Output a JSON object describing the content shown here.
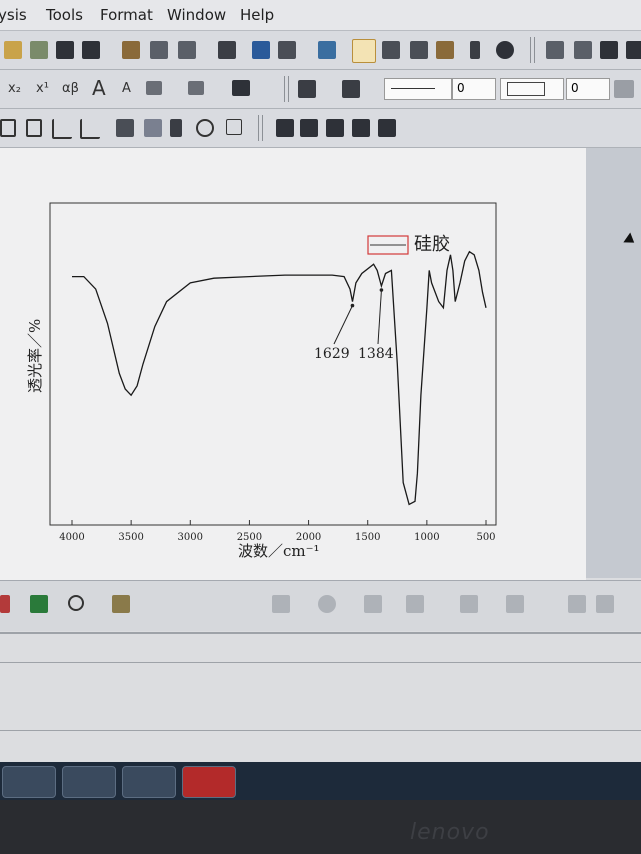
{
  "menu": {
    "items": [
      "ysis",
      "Tools",
      "Format",
      "Window",
      "Help"
    ]
  },
  "toolbar": {
    "sub_label": "x₂",
    "sup_label": "x¹",
    "greek_label": "αβ",
    "font_up_label": "A",
    "font_down_label": "A",
    "line_width_value": "0",
    "line_width_value2": "0"
  },
  "colors": {
    "legend_box": "#d33a3a",
    "curve": "#1a1a1a",
    "page": "#f0f0f1"
  },
  "chart_data": {
    "type": "line",
    "title": "",
    "xlabel": "波数／cm⁻¹",
    "ylabel": "透光率／%",
    "xlim": [
      4000,
      500
    ],
    "x_reversed": true,
    "xticks": [
      4000,
      3500,
      3000,
      2500,
      2000,
      1500,
      1000,
      500
    ],
    "y_ticks_shown": false,
    "grid": false,
    "legend": {
      "position": "top-right",
      "entries": [
        "硅胶"
      ]
    },
    "series": [
      {
        "name": "硅胶",
        "x": [
          4000,
          3900,
          3800,
          3700,
          3600,
          3550,
          3500,
          3450,
          3400,
          3300,
          3200,
          3000,
          2800,
          2500,
          2200,
          2000,
          1800,
          1700,
          1650,
          1629,
          1600,
          1550,
          1450,
          1420,
          1384,
          1350,
          1300,
          1250,
          1200,
          1150,
          1100,
          1080,
          1050,
          1000,
          980,
          960,
          900,
          860,
          830,
          800,
          780,
          760,
          720,
          680,
          640,
          600,
          560,
          530,
          500
        ],
        "y": [
          78,
          78,
          74,
          63,
          47,
          42,
          40,
          43,
          50,
          62,
          70,
          76,
          77.5,
          78,
          78.5,
          78.5,
          78.5,
          78,
          74,
          70,
          76,
          79,
          82,
          80,
          75,
          79,
          80,
          50,
          12,
          5,
          6,
          15,
          40,
          68,
          80,
          76,
          70,
          68,
          80,
          85,
          80,
          70,
          76,
          83,
          86,
          85,
          80,
          73,
          68
        ]
      }
    ],
    "annotations": [
      {
        "text": "1629",
        "x": 1629
      },
      {
        "text": "1384",
        "x": 1384
      }
    ]
  }
}
